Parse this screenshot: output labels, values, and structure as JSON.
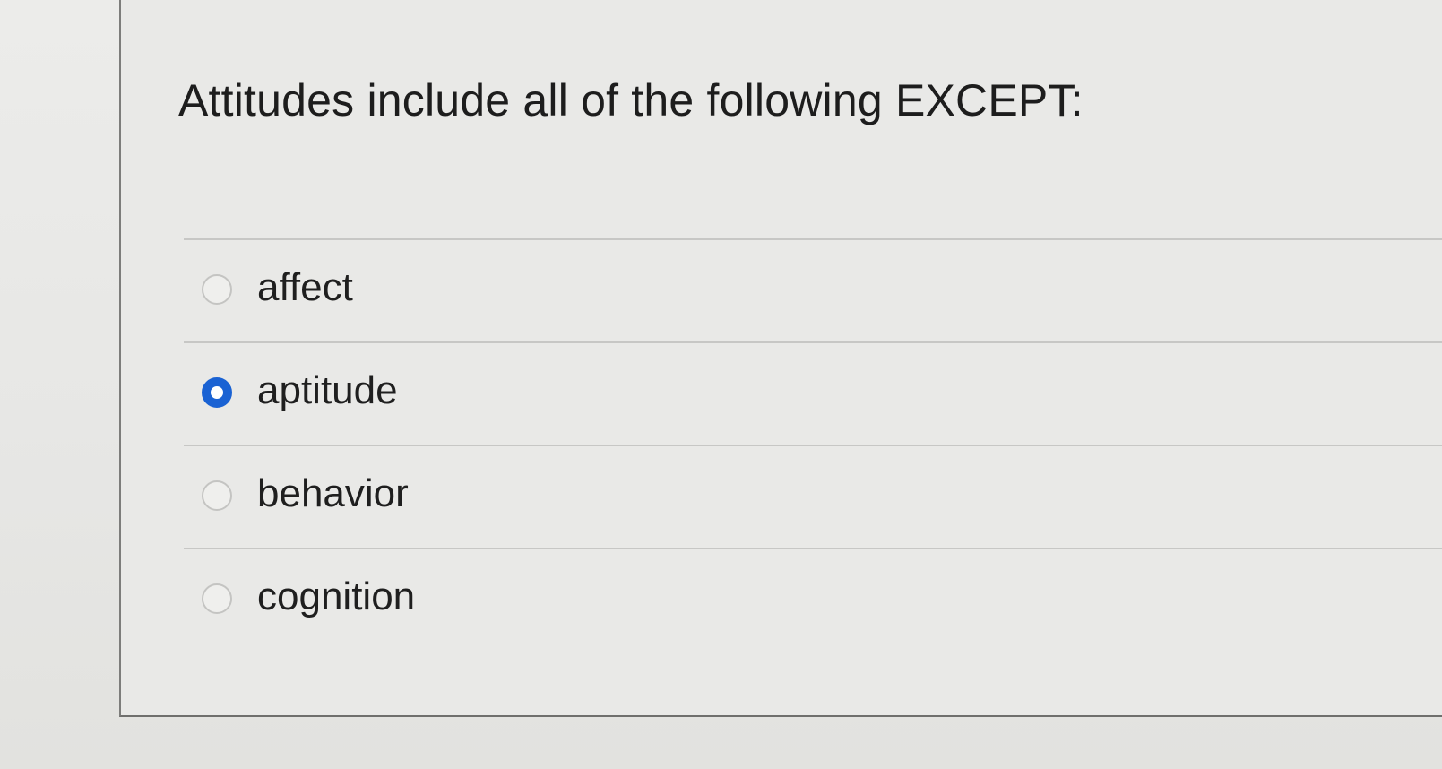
{
  "question": {
    "text": "Attitudes include all of the following EXCEPT:"
  },
  "answers": [
    {
      "label": "affect",
      "selected": false
    },
    {
      "label": "aptitude",
      "selected": true
    },
    {
      "label": "behavior",
      "selected": false
    },
    {
      "label": "cognition",
      "selected": false
    }
  ],
  "colors": {
    "selected_radio": "#1a62d3",
    "text": "#1f1f1f",
    "background": "#e9e9e7"
  }
}
